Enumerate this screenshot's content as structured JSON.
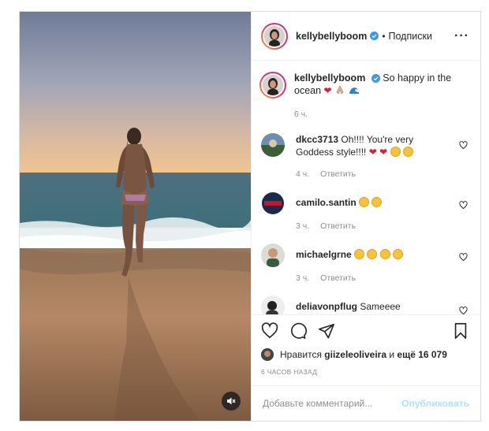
{
  "post": {
    "author": "kellybellyboom",
    "separator": "•",
    "follow_label": "Подписки",
    "more_label": "···"
  },
  "caption": {
    "author": "kellybellyboom",
    "text": "So happy in the ocean",
    "time": "6 ч."
  },
  "comments": [
    {
      "user": "dkcc3713",
      "text": "Oh!!!! You're very Goddess style!!!!",
      "time": "4 ч.",
      "reply": "Ответить"
    },
    {
      "user": "camilo.santin",
      "text": "",
      "time": "3 ч.",
      "reply": "Ответить"
    },
    {
      "user": "michaelgrne",
      "text": "",
      "time": "3 ч.",
      "reply": "Ответить"
    },
    {
      "user": "deliavonpflug",
      "text": "Sameeee"
    }
  ],
  "likes": {
    "prefix": "Нравится",
    "user": "giizeleoliveira",
    "middle": "и",
    "count_text": "ещё 16 079"
  },
  "timestamp": "6 ЧАСОВ НАЗАД",
  "add_comment": {
    "placeholder": "Добавьте комментарий...",
    "publish_label": "Опубликовать"
  },
  "colors": {
    "accent": "#0095f6",
    "publish_disabled": "#b2dffc",
    "secondary_text": "#8e8e8e"
  }
}
